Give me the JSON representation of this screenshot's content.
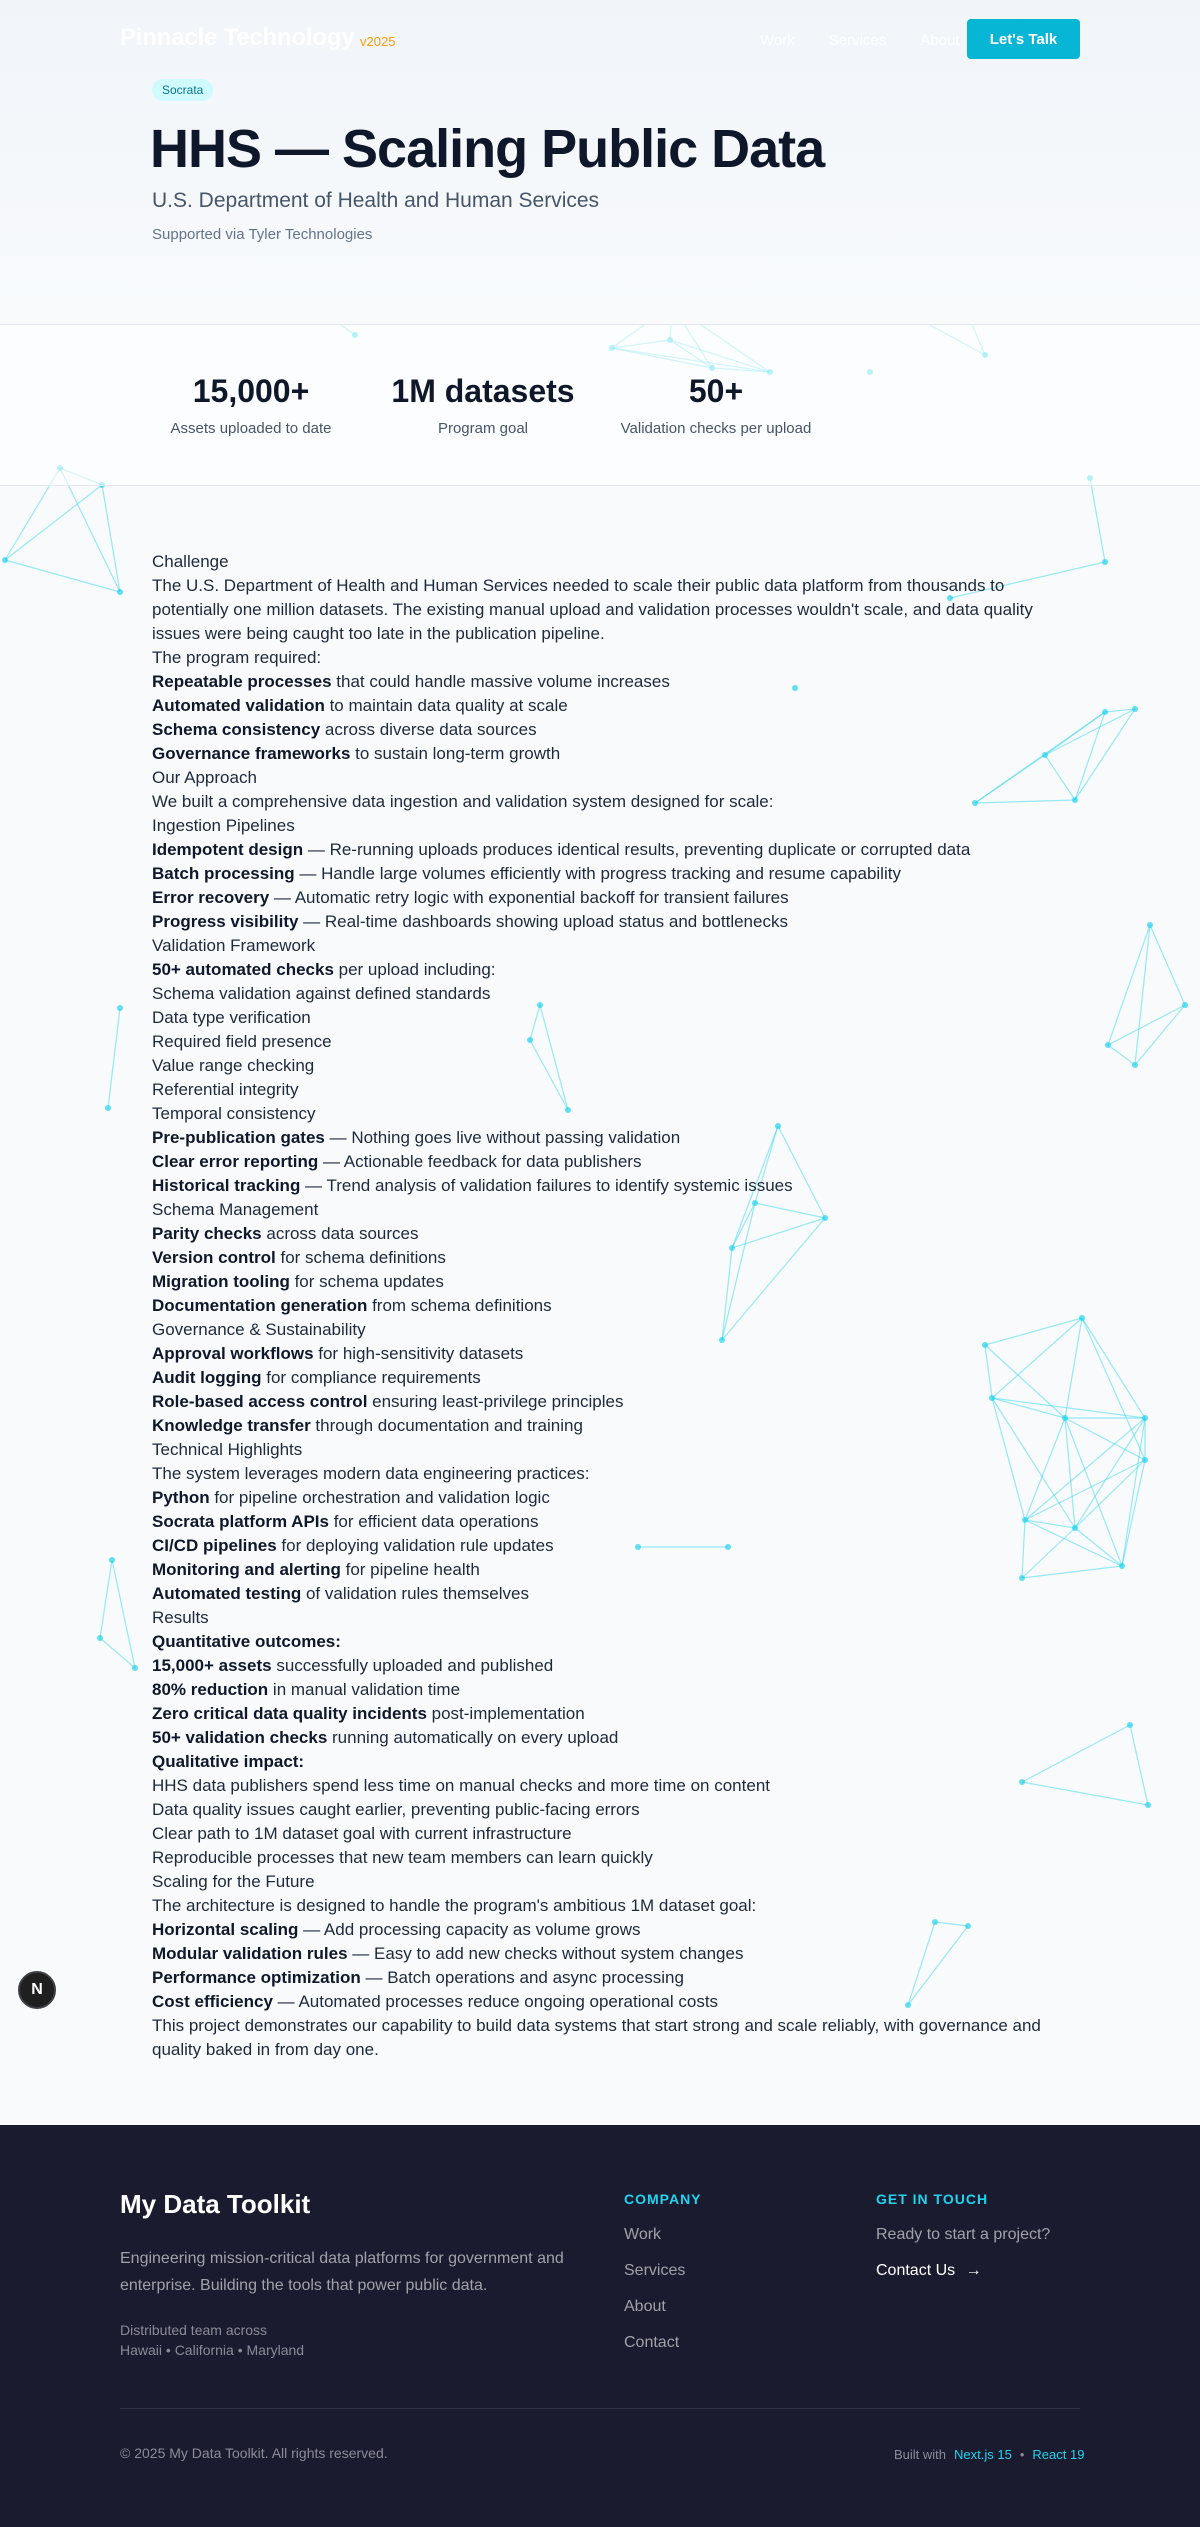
{
  "header": {
    "brand": "Pinnacle Technology",
    "version": "v2025",
    "nav": [
      "Work",
      "Services",
      "About"
    ],
    "cta": "Let's Talk"
  },
  "hero": {
    "badge": "Socrata",
    "title": "HHS — Scaling Public Data",
    "subtitle": "U.S. Department of Health and Human Services",
    "support": "Supported via Tyler Technologies"
  },
  "stats": [
    {
      "value": "15,000+",
      "label": "Assets uploaded to date"
    },
    {
      "value": "1M datasets",
      "label": "Program goal"
    },
    {
      "value": "50+",
      "label": "Validation checks per upload"
    }
  ],
  "content": [
    {
      "text": "Challenge"
    },
    {
      "text": "The U.S. Department of Health and Human Services needed to scale their public data platform from thousands to potentially one million datasets. The existing manual upload and validation processes wouldn't scale, and data quality issues were being caught too late in the publication pipeline."
    },
    {
      "text": "The program required:"
    },
    {
      "bold": "Repeatable processes",
      "text": " that could handle massive volume increases"
    },
    {
      "bold": "Automated validation",
      "text": " to maintain data quality at scale"
    },
    {
      "bold": "Schema consistency",
      "text": " across diverse data sources"
    },
    {
      "bold": "Governance frameworks",
      "text": " to sustain long-term growth"
    },
    {
      "text": "Our Approach"
    },
    {
      "text": "We built a comprehensive data ingestion and validation system designed for scale:"
    },
    {
      "text": "Ingestion Pipelines"
    },
    {
      "bold": "Idempotent design",
      "text": " — Re-running uploads produces identical results, preventing duplicate or corrupted data"
    },
    {
      "bold": "Batch processing",
      "text": " — Handle large volumes efficiently with progress tracking and resume capability"
    },
    {
      "bold": "Error recovery",
      "text": " — Automatic retry logic with exponential backoff for transient failures"
    },
    {
      "bold": "Progress visibility",
      "text": " — Real-time dashboards showing upload status and bottlenecks"
    },
    {
      "text": "Validation Framework"
    },
    {
      "bold": "50+ automated checks",
      "text": " per upload including:"
    },
    {
      "text": "Schema validation against defined standards"
    },
    {
      "text": "Data type verification"
    },
    {
      "text": "Required field presence"
    },
    {
      "text": "Value range checking"
    },
    {
      "text": "Referential integrity"
    },
    {
      "text": "Temporal consistency"
    },
    {
      "bold": "Pre-publication gates",
      "text": " — Nothing goes live without passing validation"
    },
    {
      "bold": "Clear error reporting",
      "text": " — Actionable feedback for data publishers"
    },
    {
      "bold": "Historical tracking",
      "text": " — Trend analysis of validation failures to identify systemic issues"
    },
    {
      "text": "Schema Management"
    },
    {
      "bold": "Parity checks",
      "text": " across data sources"
    },
    {
      "bold": "Version control",
      "text": " for schema definitions"
    },
    {
      "bold": "Migration tooling",
      "text": " for schema updates"
    },
    {
      "bold": "Documentation generation",
      "text": " from schema definitions"
    },
    {
      "text": "Governance & Sustainability"
    },
    {
      "bold": "Approval workflows",
      "text": " for high-sensitivity datasets"
    },
    {
      "bold": "Audit logging",
      "text": " for compliance requirements"
    },
    {
      "bold": "Role-based access control",
      "text": " ensuring least-privilege principles"
    },
    {
      "bold": "Knowledge transfer",
      "text": " through documentation and training"
    },
    {
      "text": "Technical Highlights"
    },
    {
      "text": "The system leverages modern data engineering practices:"
    },
    {
      "bold": "Python",
      "text": " for pipeline orchestration and validation logic"
    },
    {
      "bold": "Socrata platform APIs",
      "text": " for efficient data operations"
    },
    {
      "bold": "CI/CD pipelines",
      "text": " for deploying validation rule updates"
    },
    {
      "bold": "Monitoring and alerting",
      "text": " for pipeline health"
    },
    {
      "bold": "Automated testing",
      "text": " of validation rules themselves"
    },
    {
      "text": "Results"
    },
    {
      "bold": "Quantitative outcomes:",
      "text": ""
    },
    {
      "bold": "15,000+ assets",
      "text": " successfully uploaded and published"
    },
    {
      "bold": "80% reduction",
      "text": " in manual validation time"
    },
    {
      "bold": "Zero critical data quality incidents",
      "text": " post-implementation"
    },
    {
      "bold": "50+ validation checks",
      "text": " running automatically on every upload"
    },
    {
      "bold": "Qualitative impact:",
      "text": ""
    },
    {
      "text": "HHS data publishers spend less time on manual checks and more time on content"
    },
    {
      "text": "Data quality issues caught earlier, preventing public-facing errors"
    },
    {
      "text": "Clear path to 1M dataset goal with current infrastructure"
    },
    {
      "text": "Reproducible processes that new team members can learn quickly"
    },
    {
      "text": "Scaling for the Future"
    },
    {
      "text": "The architecture is designed to handle the program's ambitious 1M dataset goal:"
    },
    {
      "bold": "Horizontal scaling",
      "text": " — Add processing capacity as volume grows"
    },
    {
      "bold": "Modular validation rules",
      "text": " — Easy to add new checks without system changes"
    },
    {
      "bold": "Performance optimization",
      "text": " — Batch operations and async processing"
    },
    {
      "bold": "Cost efficiency",
      "text": " — Automated processes reduce ongoing operational costs"
    },
    {
      "text": "This project demonstrates our capability to build data systems that start strong and scale reliably, with governance and quality baked in from day one."
    }
  ],
  "fab": {
    "letter": "N"
  },
  "footer": {
    "name": "My Data Toolkit",
    "tagline": "Engineering mission-critical data platforms for government and enterprise. Building the tools that power public data.",
    "location_line1": "Distributed team across",
    "location_line2": "Hawaii • California • Maryland",
    "company_heading": "COMPANY",
    "company_links": [
      "Work",
      "Services",
      "About",
      "Contact"
    ],
    "contact_heading": "GET IN TOUCH",
    "contact_prompt": "Ready to start a project?",
    "contact_link": "Contact Us",
    "contact_arrow": "→",
    "copyright": "© 2025 My Data Toolkit. All rights reserved.",
    "built_with": "Built with",
    "tech1": "Next.js 15",
    "separator": "•",
    "tech2": "React 19"
  },
  "colors": {
    "accent": "#06b6d4",
    "network": "#22d3ee",
    "footer_bg": "#1b1b2f",
    "badge_bg": "#cffafe"
  }
}
